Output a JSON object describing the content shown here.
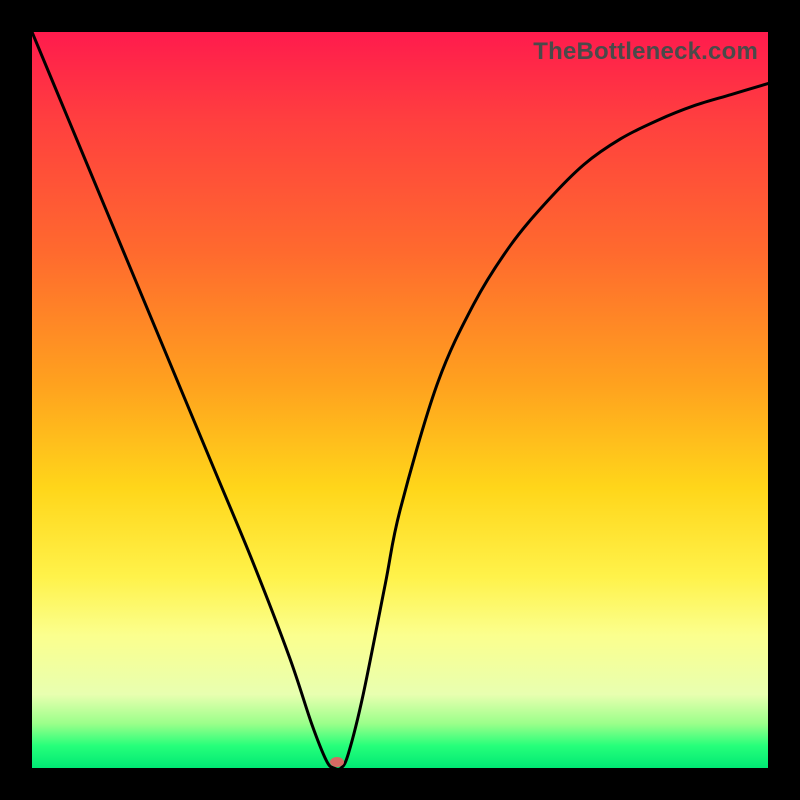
{
  "watermark": "TheBottleneck.com",
  "colors": {
    "frame": "#000000",
    "curve": "#000000",
    "marker": "#d46a63",
    "gradient_top": "#ff1b4d",
    "gradient_bottom": "#00e874"
  },
  "chart_data": {
    "type": "line",
    "title": "",
    "xlabel": "",
    "ylabel": "",
    "xlim": [
      0,
      100
    ],
    "ylim": [
      0,
      100
    ],
    "x": [
      0,
      5,
      10,
      15,
      20,
      25,
      30,
      35,
      38,
      40,
      41,
      42,
      43,
      45,
      48,
      50,
      55,
      60,
      65,
      70,
      75,
      80,
      85,
      90,
      95,
      100
    ],
    "values": [
      100,
      88,
      76,
      64,
      52,
      40,
      28,
      15,
      6,
      1,
      0,
      0,
      2,
      10,
      25,
      35,
      52,
      63,
      71,
      77,
      82,
      85.5,
      88,
      90,
      91.5,
      93
    ],
    "minimum": {
      "x": 41,
      "y": 0
    },
    "marker": {
      "x": 41.5,
      "y": 0.8
    },
    "annotations": []
  }
}
